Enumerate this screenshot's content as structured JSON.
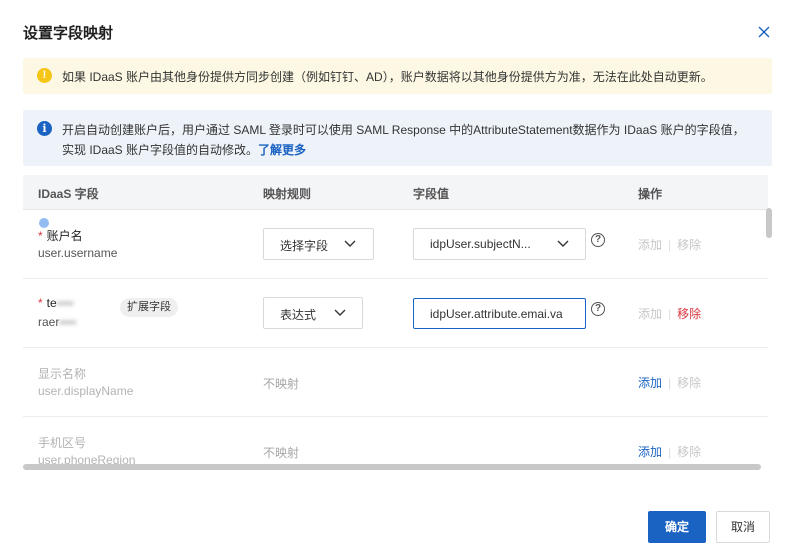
{
  "dialog": {
    "title": "设置字段映射",
    "close_icon": "close-icon"
  },
  "warning": {
    "icon": "warning-icon",
    "text": "如果 IDaaS 账户由其他身份提供方同步创建（例如钉钉、AD），账户数据将以其他身份提供方为准，无法在此处自动更新。"
  },
  "info": {
    "icon": "info-icon",
    "line1": "开启自动创建账户后，用户通过 SAML 登录时可以使用 SAML Response 中的AttributeStatement数据作为 IDaaS 账户的字段值，",
    "line2_prefix": "实现 IDaaS 账户字段值的自动修改。",
    "learn_more": "了解更多"
  },
  "table": {
    "headers": [
      "IDaaS 字段",
      "映射规则",
      "字段值",
      "操作"
    ],
    "rows": [
      {
        "label": "账户名",
        "key": "user.username",
        "required": true,
        "rule": "选择字段",
        "value": "idpUser.subjectN...",
        "add": "添加",
        "remove": "移除"
      },
      {
        "label": "te",
        "label_masked": "▪▪▪▪",
        "key": "raer",
        "key_masked": "▪▪▪▪",
        "required": true,
        "tag": "扩展字段",
        "rule": "表达式",
        "value": "idpUser.attribute.emai.va",
        "add": "添加",
        "remove": "移除"
      },
      {
        "label": "显示名称",
        "key": "user.displayName",
        "required": false,
        "rule": "不映射",
        "add": "添加",
        "remove": "移除"
      },
      {
        "label": "手机区号",
        "key": "user.phoneRegion",
        "required": false,
        "rule": "不映射",
        "add": "添加",
        "remove": "移除"
      }
    ],
    "required_mark": "*",
    "help_mark": "?"
  },
  "footer": {
    "ok": "确定",
    "cancel": "取消"
  },
  "colors": {
    "primary": "#1b63c3",
    "danger": "#d9363e",
    "warning_bg": "#fdf8e4",
    "info_bg": "#eef3f9"
  }
}
